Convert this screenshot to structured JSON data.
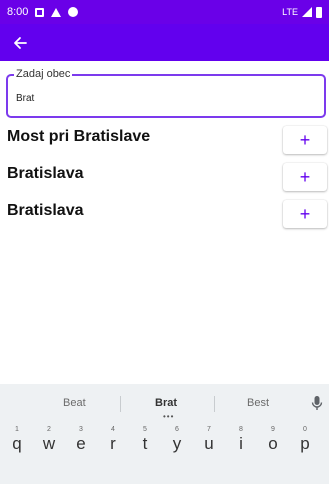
{
  "status_bar": {
    "time": "8:00",
    "network": "LTE"
  },
  "app_bar": {
    "back_icon": "arrow-back-icon"
  },
  "search": {
    "label": "Zadaj obec",
    "value": "Brat"
  },
  "results": [
    {
      "name": "Most pri Bratislave",
      "action": "+"
    },
    {
      "name": "Bratislava",
      "action": "+"
    },
    {
      "name": "Bratislava",
      "action": "+"
    }
  ],
  "keyboard": {
    "suggestions": [
      "Beat",
      "Brat",
      "Best"
    ],
    "row1": [
      {
        "num": "1",
        "letter": "q"
      },
      {
        "num": "2",
        "letter": "w"
      },
      {
        "num": "3",
        "letter": "e"
      },
      {
        "num": "4",
        "letter": "r"
      },
      {
        "num": "5",
        "letter": "t"
      },
      {
        "num": "6",
        "letter": "y"
      },
      {
        "num": "7",
        "letter": "u"
      },
      {
        "num": "8",
        "letter": "i"
      },
      {
        "num": "9",
        "letter": "o"
      },
      {
        "num": "0",
        "letter": "p"
      }
    ]
  },
  "colors": {
    "primary": "#6200ee",
    "status_bar": "#6a00e8",
    "accent_border": "#7c3aed"
  }
}
